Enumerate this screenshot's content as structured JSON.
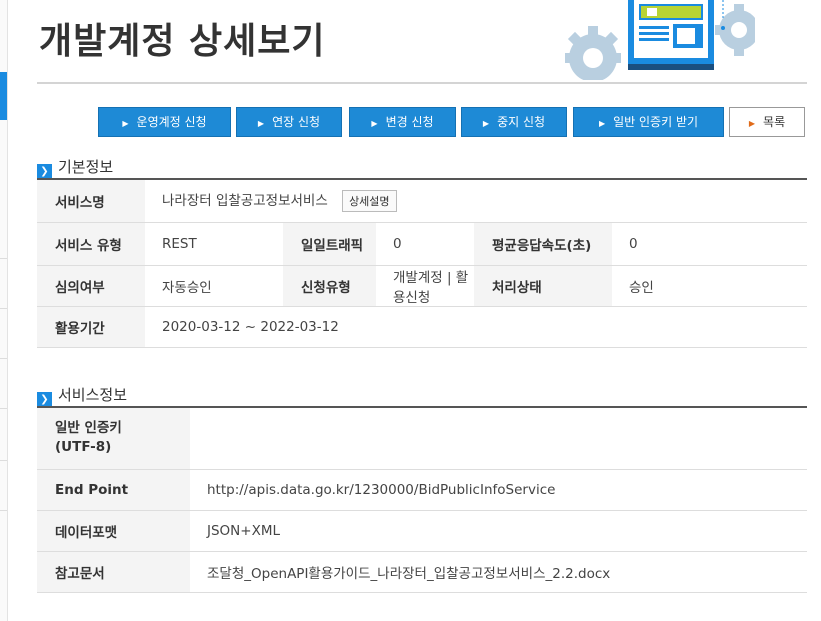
{
  "page": {
    "title": "개발계정 상세보기"
  },
  "buttons": [
    {
      "label": "운영계정 신청",
      "primary": true
    },
    {
      "label": "연장 신청",
      "primary": true
    },
    {
      "label": "변경 신청",
      "primary": true
    },
    {
      "label": "중지 신청",
      "primary": true
    },
    {
      "label": "일반 인증키 받기",
      "primary": true
    },
    {
      "label": "목록",
      "primary": false
    }
  ],
  "basic": {
    "section_title": "기본정보",
    "service_name_label": "서비스명",
    "service_name": "나라장터 입찰공고정보서비스",
    "detail_button": "상세설명",
    "service_type_label": "서비스 유형",
    "service_type": "REST",
    "daily_traffic_label": "일일트래픽",
    "daily_traffic": "0",
    "avg_response_label": "평균응답속도(초)",
    "avg_response": "0",
    "review_label": "심의여부",
    "review": "자동승인",
    "request_type_label": "신청유형",
    "request_type": "개발계정 | 활용신청",
    "status_label": "처리상태",
    "status": "승인",
    "period_label": "활용기간",
    "period": "2020-03-12 ~ 2022-03-12"
  },
  "service": {
    "section_title": "서비스정보",
    "key_label_1": "일반 인증키",
    "key_label_2": "(UTF-8)",
    "key_value": "",
    "endpoint_label": "End Point",
    "endpoint": "http://apis.data.go.kr/1230000/BidPublicInfoService",
    "format_label": "데이터포맷",
    "format": "JSON+XML",
    "doc_label": "참고문서",
    "doc": "조달청_OpenAPI활용가이드_나라장터_입찰공고정보서비스_2.2.docx"
  },
  "colors": {
    "accent": "#1e8ad6",
    "header_line": "#d4d4d4"
  }
}
